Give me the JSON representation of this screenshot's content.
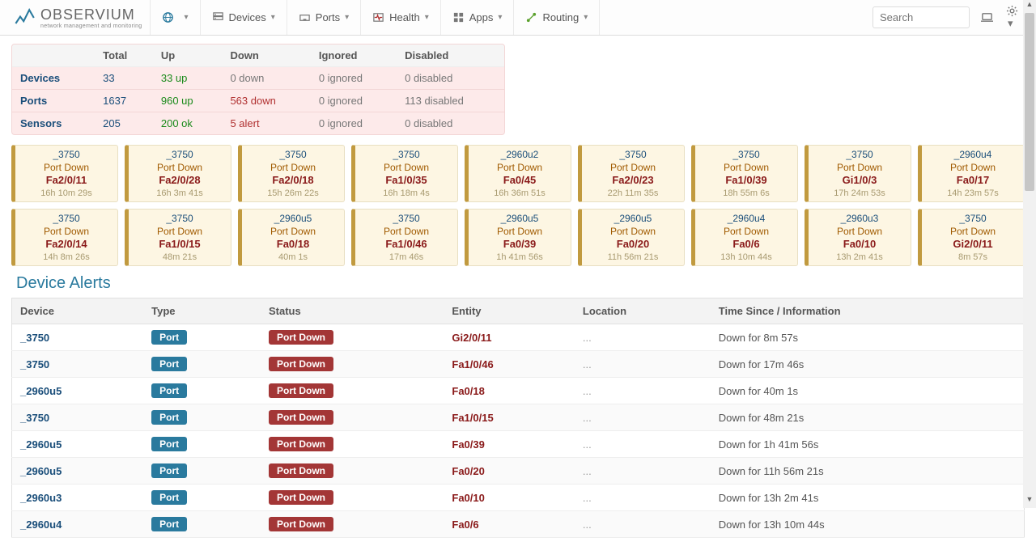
{
  "nav": {
    "brand": "OBSERVIUM",
    "tagline": "network management and monitoring",
    "items": [
      {
        "label": "",
        "icon": "globe"
      },
      {
        "label": "Devices",
        "icon": "server"
      },
      {
        "label": "Ports",
        "icon": "port"
      },
      {
        "label": "Health",
        "icon": "health"
      },
      {
        "label": "Apps",
        "icon": "apps"
      },
      {
        "label": "Routing",
        "icon": "routing"
      }
    ],
    "search_placeholder": "Search"
  },
  "summary": {
    "headers": [
      "",
      "Total",
      "Up",
      "Down",
      "Ignored",
      "Disabled"
    ],
    "rows": [
      {
        "label": "Devices",
        "total": "33",
        "up": "33 up",
        "down": "0 down",
        "ignored": "0 ignored",
        "disabled": "0 disabled"
      },
      {
        "label": "Ports",
        "total": "1637",
        "up": "960 up",
        "down": "563 down",
        "ignored": "0 ignored",
        "disabled": "113 disabled"
      },
      {
        "label": "Sensors",
        "total": "205",
        "up": "200 ok",
        "down": "5 alert",
        "ignored": "0 ignored",
        "disabled": "0 disabled"
      }
    ]
  },
  "cards": [
    {
      "host": "_3750",
      "status": "Port Down",
      "entity": "Fa2/0/11",
      "time": "16h 10m 29s"
    },
    {
      "host": "_3750",
      "status": "Port Down",
      "entity": "Fa2/0/28",
      "time": "16h 3m 41s"
    },
    {
      "host": "_3750",
      "status": "Port Down",
      "entity": "Fa2/0/18",
      "time": "15h 26m 22s"
    },
    {
      "host": "_3750",
      "status": "Port Down",
      "entity": "Fa1/0/35",
      "time": "16h 18m 4s"
    },
    {
      "host": "_2960u2",
      "status": "Port Down",
      "entity": "Fa0/45",
      "time": "16h 36m 51s"
    },
    {
      "host": "_3750",
      "status": "Port Down",
      "entity": "Fa2/0/23",
      "time": "22h 11m 35s"
    },
    {
      "host": "_3750",
      "status": "Port Down",
      "entity": "Fa1/0/39",
      "time": "18h 55m 6s"
    },
    {
      "host": "_3750",
      "status": "Port Down",
      "entity": "Gi1/0/3",
      "time": "17h 24m 53s"
    },
    {
      "host": "_2960u4",
      "status": "Port Down",
      "entity": "Fa0/17",
      "time": "14h 23m 57s"
    },
    {
      "host": "_3750",
      "status": "Port Down",
      "entity": "Fa2/0/14",
      "time": "14h 8m 26s"
    },
    {
      "host": "_3750",
      "status": "Port Down",
      "entity": "Fa1/0/15",
      "time": "48m 21s"
    },
    {
      "host": "_2960u5",
      "status": "Port Down",
      "entity": "Fa0/18",
      "time": "40m 1s"
    },
    {
      "host": "_3750",
      "status": "Port Down",
      "entity": "Fa1/0/46",
      "time": "17m 46s"
    },
    {
      "host": "_2960u5",
      "status": "Port Down",
      "entity": "Fa0/39",
      "time": "1h 41m 56s"
    },
    {
      "host": "_2960u5",
      "status": "Port Down",
      "entity": "Fa0/20",
      "time": "11h 56m 21s"
    },
    {
      "host": "_2960u4",
      "status": "Port Down",
      "entity": "Fa0/6",
      "time": "13h 10m 44s"
    },
    {
      "host": "_2960u3",
      "status": "Port Down",
      "entity": "Fa0/10",
      "time": "13h 2m 41s"
    },
    {
      "host": "_3750",
      "status": "Port Down",
      "entity": "Gi2/0/11",
      "time": "8m 57s"
    }
  ],
  "alerts_title": "Device Alerts",
  "alerts_headers": [
    "Device",
    "Type",
    "Status",
    "Entity",
    "Location",
    "Time Since / Information"
  ],
  "badge_type": "Port",
  "badge_status": "Port Down",
  "alerts": [
    {
      "device": "_3750",
      "entity": "Gi2/0/11",
      "loc": "...",
      "info": "Down for 8m 57s"
    },
    {
      "device": "_3750",
      "entity": "Fa1/0/46",
      "loc": "...",
      "info": "Down for 17m 46s"
    },
    {
      "device": "_2960u5",
      "entity": "Fa0/18",
      "loc": "...",
      "info": "Down for 40m 1s"
    },
    {
      "device": "_3750",
      "entity": "Fa1/0/15",
      "loc": "...",
      "info": "Down for 48m 21s"
    },
    {
      "device": "_2960u5",
      "entity": "Fa0/39",
      "loc": "...",
      "info": "Down for 1h 41m 56s"
    },
    {
      "device": "_2960u5",
      "entity": "Fa0/20",
      "loc": "...",
      "info": "Down for 11h 56m 21s"
    },
    {
      "device": "_2960u3",
      "entity": "Fa0/10",
      "loc": "...",
      "info": "Down for 13h 2m 41s"
    },
    {
      "device": "_2960u4",
      "entity": "Fa0/6",
      "loc": "...",
      "info": "Down for 13h 10m 44s"
    }
  ]
}
